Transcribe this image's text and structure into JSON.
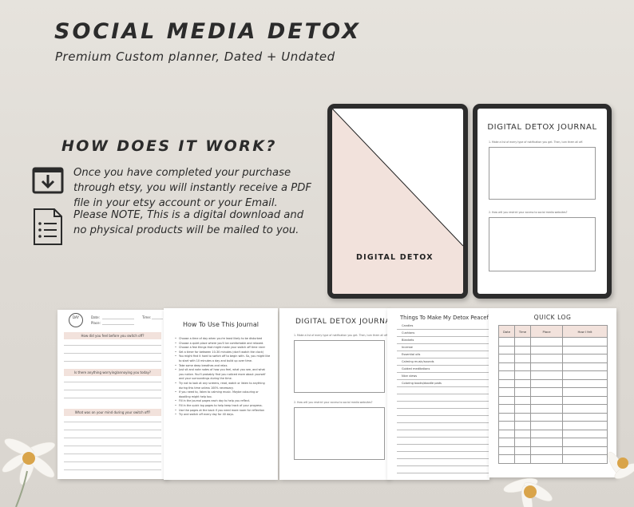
{
  "header": {
    "title": "SOCIAL MEDIA DETOX",
    "subtitle": "Premium Custom planner, Dated + Undated"
  },
  "how": {
    "heading": "HOW DOES IT WORK?",
    "steps": [
      {
        "icon": "download-icon",
        "text": "Once you have completed your purchase through etsy, you will instantly receive a PDF file in your etsy account or your Email."
      },
      {
        "icon": "document-list-icon",
        "text": "Please NOTE, This is a digital download and no physical products will be mailed to you."
      }
    ]
  },
  "tablets": {
    "cover_label": "DIGITAL DETOX",
    "journal_title": "DIGITAL DETOX JOURNAL",
    "journal_q1": "1. Make a list of every type of notification you get. Then, turn them all off.",
    "journal_q2": "2. How will you restrict your access to social media websites?"
  },
  "pages": {
    "daily": {
      "day": "DAY",
      "date": "Date:",
      "place": "Place:",
      "time": "Time:",
      "questions": [
        "How did you feel before you switch off?",
        "Is there anything worrying/annoying you today?",
        "What was on your mind during your switch off?"
      ]
    },
    "how_to": {
      "title": "How To Use This Journal",
      "items": [
        "Choose a time of day when you're least likely to be disturbed",
        "Choose a quiet place where you'll be comfortable and relaxed.",
        "Choose a few things that might make your switch off time nicer",
        "Set a timer for between 10-30 minutes (don't watch the clock)",
        "You might find it hard to switch off to begin with. So, you might like to start with 10 minutes a day and build up over time.",
        "Take some deep breathes and relax.",
        "Just sit and note notes of how you feel, what you see, and what you notice. You'll probably find you noticed more about yourself and your surroundings during the time.",
        "Try not to look at any screens, read, watch or listen to anything during this time unless 100% necessary.",
        "If you need to, listen to calming music. Maybe colouring or doodling might help too.",
        "Fill in the journal pages each day to help you reflect.",
        "Fill in the quick log pages to help keep track of your progress.",
        "Use the pages at the back if you need more room for reflection",
        "Try and switch off every day for 40 days."
      ]
    },
    "journal": {
      "title": "DIGITAL DETOX JOURNAL",
      "q1": "1. Make a list of every type of notification you get. Then, turn them all off.",
      "q2": "2. How will you restrict your access to social media websites?"
    },
    "things": {
      "title": "Things To Make My Detox Peaceful",
      "items": [
        "Candles",
        "Cushions",
        "Blankets",
        "Incense",
        "Essential oils",
        "Calming music/sounds",
        "Guided meditations",
        "Nice views",
        "Coloring books/doodle pads"
      ]
    },
    "quick_log": {
      "title": "QUICK LOG",
      "columns": [
        "Date",
        "Time",
        "Place",
        "How I felt"
      ]
    }
  },
  "colors": {
    "background": "#e3e0da",
    "blush": "#f2e2dc",
    "text": "#2b2b2b",
    "tablet_frame": "#2c2c2c"
  }
}
